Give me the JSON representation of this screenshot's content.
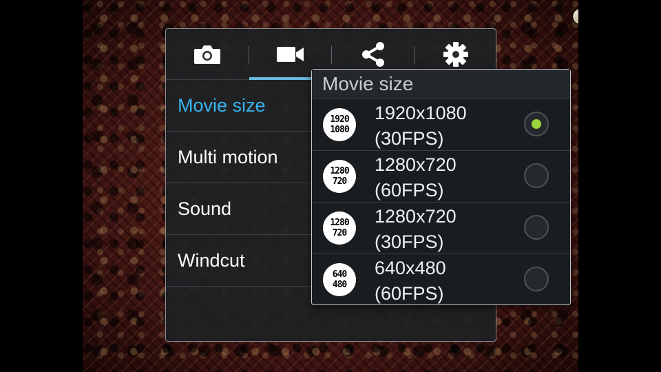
{
  "tabs": [
    {
      "icon": "camera-icon"
    },
    {
      "icon": "video-camera-icon",
      "selected": true
    },
    {
      "icon": "share-icon"
    },
    {
      "icon": "gear-icon"
    }
  ],
  "menu": {
    "items": [
      {
        "label": "Movie size",
        "active": true
      },
      {
        "label": "Multi motion"
      },
      {
        "label": "Sound"
      },
      {
        "label": "Windcut"
      }
    ]
  },
  "dialog": {
    "title": "Movie size",
    "options": [
      {
        "icon_top": "1920",
        "icon_bottom": "1080",
        "line1": "1920x1080",
        "line2": "(30FPS)",
        "selected": true
      },
      {
        "icon_top": "1280",
        "icon_bottom": "720",
        "line1": "1280x720",
        "line2": "(60FPS)",
        "selected": false
      },
      {
        "icon_top": "1280",
        "icon_bottom": "720",
        "line1": "1280x720",
        "line2": "(30FPS)",
        "selected": false
      },
      {
        "icon_top": "640",
        "icon_bottom": "480",
        "line1": "640x480",
        "line2": "(60FPS)",
        "selected": false
      }
    ]
  },
  "colors": {
    "accent": "#36b5ee",
    "tab_indicator": "#68b8e0",
    "radio_selected": "#9ad63b"
  }
}
